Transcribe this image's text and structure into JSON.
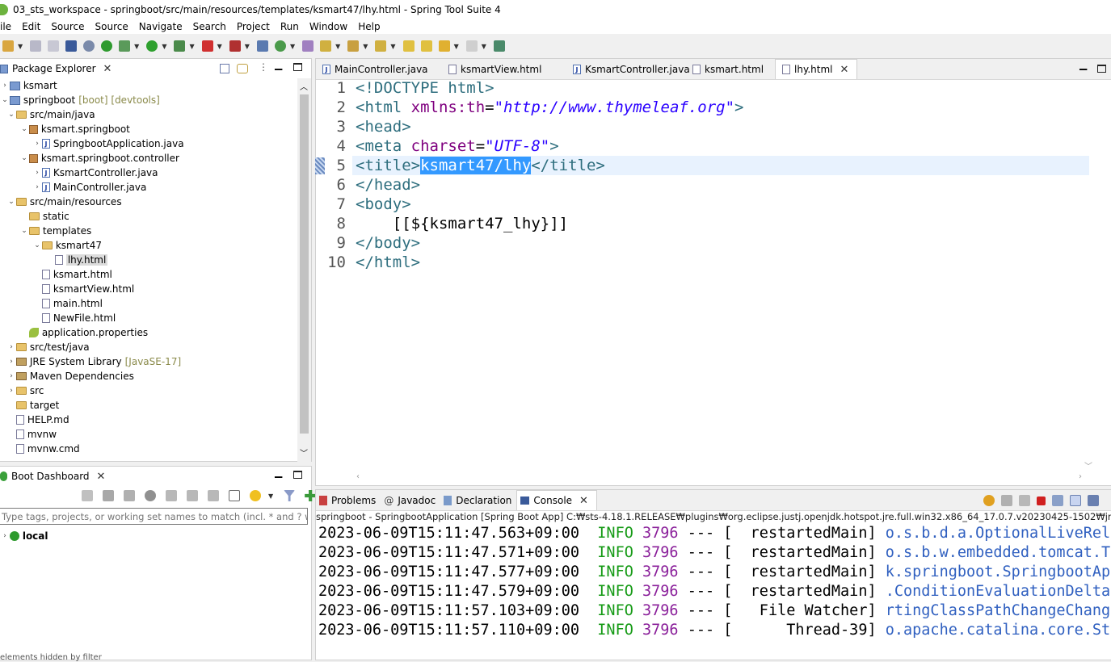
{
  "window": {
    "title": "03_sts_workspace - springboot/src/main/resources/templates/ksmart47/lhy.html - Spring Tool Suite 4"
  },
  "menu": [
    "ile",
    "Edit",
    "Source",
    "Source",
    "Navigate",
    "Search",
    "Project",
    "Run",
    "Window",
    "Help"
  ],
  "package_explorer": {
    "title": "Package Explorer",
    "items": [
      {
        "label": "ksmart",
        "decoration": ""
      },
      {
        "label": "springboot",
        "decoration": "[boot] [devtools]"
      },
      {
        "label": "src/main/java",
        "decoration": ""
      },
      {
        "label": "ksmart.springboot",
        "decoration": ""
      },
      {
        "label": "SpringbootApplication.java",
        "decoration": ""
      },
      {
        "label": "ksmart.springboot.controller",
        "decoration": ""
      },
      {
        "label": "KsmartController.java",
        "decoration": ""
      },
      {
        "label": "MainController.java",
        "decoration": ""
      },
      {
        "label": "src/main/resources",
        "decoration": ""
      },
      {
        "label": "static",
        "decoration": ""
      },
      {
        "label": "templates",
        "decoration": ""
      },
      {
        "label": "ksmart47",
        "decoration": ""
      },
      {
        "label": "lhy.html",
        "decoration": ""
      },
      {
        "label": "ksmart.html",
        "decoration": ""
      },
      {
        "label": "ksmartView.html",
        "decoration": ""
      },
      {
        "label": "main.html",
        "decoration": ""
      },
      {
        "label": "NewFile.html",
        "decoration": ""
      },
      {
        "label": "application.properties",
        "decoration": ""
      },
      {
        "label": "src/test/java",
        "decoration": ""
      },
      {
        "label": "JRE System Library",
        "decoration": "[JavaSE-17]"
      },
      {
        "label": "Maven Dependencies",
        "decoration": ""
      },
      {
        "label": "src",
        "decoration": ""
      },
      {
        "label": "target",
        "decoration": ""
      },
      {
        "label": "HELP.md",
        "decoration": ""
      },
      {
        "label": "mvnw",
        "decoration": ""
      },
      {
        "label": "mvnw.cmd",
        "decoration": ""
      }
    ]
  },
  "boot_dashboard": {
    "title": "Boot Dashboard",
    "filter_placeholder": "Type tags, projects, or working set names to match (incl. * and ? wildcards)",
    "local_label": "local"
  },
  "editor": {
    "tabs": [
      "MainController.java",
      "ksmartView.html",
      "KsmartController.java",
      "ksmart.html",
      "lhy.html"
    ],
    "active_tab": "lhy.html",
    "lines": [
      {
        "n": "1",
        "parts": [
          [
            "tag",
            "<!DOCTYPE html>"
          ]
        ]
      },
      {
        "n": "2",
        "parts": [
          [
            "tag",
            "<html "
          ],
          [
            "attr",
            "xmlns:th"
          ],
          [
            "plain",
            "="
          ],
          [
            "str",
            "\"http://www.thymeleaf.org\""
          ],
          [
            "tag",
            ">"
          ]
        ]
      },
      {
        "n": "3",
        "parts": [
          [
            "tag",
            "<head>"
          ]
        ]
      },
      {
        "n": "4",
        "parts": [
          [
            "tag",
            "<meta "
          ],
          [
            "attr",
            "charset"
          ],
          [
            "plain",
            "="
          ],
          [
            "str",
            "\"UTF-8\""
          ],
          [
            "tag",
            ">"
          ]
        ]
      },
      {
        "n": "5",
        "parts": [
          [
            "tag",
            "<title>"
          ],
          [
            "sel",
            "ksmart47/lhy"
          ],
          [
            "tag",
            "</title>"
          ]
        ]
      },
      {
        "n": "6",
        "parts": [
          [
            "tag",
            "</head>"
          ]
        ]
      },
      {
        "n": "7",
        "parts": [
          [
            "tag",
            "<body>"
          ]
        ]
      },
      {
        "n": "8",
        "parts": [
          [
            "plain",
            "    [[${ksmart47_lhy}]]"
          ]
        ]
      },
      {
        "n": "9",
        "parts": [
          [
            "tag",
            "</body>"
          ]
        ]
      },
      {
        "n": "10",
        "parts": [
          [
            "tag",
            "</html>"
          ]
        ]
      }
    ]
  },
  "bottom_panel": {
    "tabs": [
      "Problems",
      "Javadoc",
      "Declaration",
      "Console"
    ],
    "active_tab": "Console",
    "console_header": "springboot - SpringbootApplication [Spring Boot App] C:₩sts-4.18.1.RELEASE₩plugins₩org.eclipse.justj.openjdk.hotspot.jre.full.win32.x86_64_17.0.7.v20230425-1502₩jre₩bin₩javaw.exe",
    "log_lines": [
      {
        "ts": "2023-06-09T15:11:47.563+09:00",
        "level": "INFO",
        "pid": "3796",
        "sep": " --- [",
        "thread": "  restartedMain]",
        "logger": " o.s.b.d.a.OptionalLiveReloadServer"
      },
      {
        "ts": "2023-06-09T15:11:47.571+09:00",
        "level": "INFO",
        "pid": "3796",
        "sep": " --- [",
        "thread": "  restartedMain]",
        "logger": " o.s.b.w.embedded.tomcat.TomcatWebServer"
      },
      {
        "ts": "2023-06-09T15:11:47.577+09:00",
        "level": "INFO",
        "pid": "3796",
        "sep": " --- [",
        "thread": "  restartedMain]",
        "logger": " k.springboot.SpringbootApplication"
      },
      {
        "ts": "2023-06-09T15:11:47.579+09:00",
        "level": "INFO",
        "pid": "3796",
        "sep": " --- [",
        "thread": "  restartedMain]",
        "logger": " .ConditionEvaluationDeltaLoggingListener"
      },
      {
        "ts": "2023-06-09T15:11:57.103+09:00",
        "level": "INFO",
        "pid": "3796",
        "sep": " --- [",
        "thread": "   File Watcher]",
        "logger": " rtingClassPathChangeChangedEventListener"
      },
      {
        "ts": "2023-06-09T15:11:57.110+09:00",
        "level": "INFO",
        "pid": "3796",
        "sep": " --- [",
        "thread": "      Thread-39]",
        "logger": " o.apache.catalina.core.StandardService"
      }
    ]
  },
  "status_bar": {
    "text": "elements hidden by filter"
  },
  "colors": {
    "selection": "#3399ff",
    "current_line": "#e8f2fe",
    "tag": "#2e6e7e",
    "attr": "#7f007f",
    "string": "#2a00ff",
    "info": "#159a15"
  }
}
